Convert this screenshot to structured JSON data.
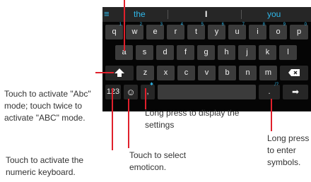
{
  "keyboard": {
    "suggestions": {
      "left": "the",
      "middle": "I",
      "right": "you"
    },
    "row1": [
      {
        "key": "q",
        "hint": "1"
      },
      {
        "key": "w",
        "hint": "2"
      },
      {
        "key": "e",
        "hint": "3"
      },
      {
        "key": "r",
        "hint": "4"
      },
      {
        "key": "t",
        "hint": "5"
      },
      {
        "key": "y",
        "hint": "6"
      },
      {
        "key": "u",
        "hint": "7"
      },
      {
        "key": "i",
        "hint": "8"
      },
      {
        "key": "o",
        "hint": "9"
      },
      {
        "key": "p",
        "hint": "0"
      }
    ],
    "row2": [
      "a",
      "s",
      "d",
      "f",
      "g",
      "h",
      "j",
      "k",
      "l"
    ],
    "row3": [
      "z",
      "x",
      "c",
      "v",
      "b",
      "n",
      "m"
    ],
    "bottom": {
      "numbers_label": "123",
      "emoticon_symbol": "☺",
      "settings_key": ",",
      "settings_hint": "✱",
      "period_key": ".",
      "period_hint": ",!?",
      "enter_symbol": "➡"
    }
  },
  "annotations": {
    "shift_text": "Touch to activate \"Abc\" mode; touch twice to activate \"ABC\" mode.",
    "numeric_text": "Touch to activate the numeric keyboard.",
    "emoticon_text": "Touch to select emoticon.",
    "settings_text": "Long press to display the settings",
    "symbols_text": "Long press to enter symbols."
  }
}
